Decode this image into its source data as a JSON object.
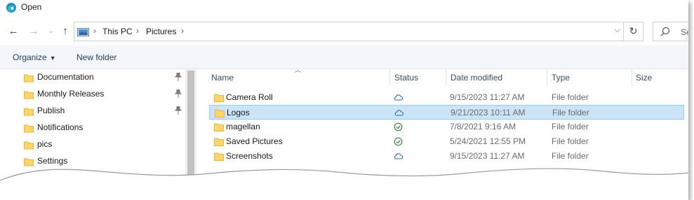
{
  "window": {
    "title": "Open"
  },
  "nav": {
    "back_icon": "arrow-left-icon",
    "forward_icon": "arrow-right-icon",
    "recent_icon": "chevron-down-icon",
    "up_icon": "arrow-up-icon"
  },
  "address": {
    "crumbs": [
      "This PC",
      "Pictures"
    ],
    "separator": "›"
  },
  "search": {
    "placeholder": "Se"
  },
  "commands": {
    "organize": "Organize",
    "new_folder": "New folder"
  },
  "sidebar": {
    "items": [
      {
        "label": "Documentation",
        "pinned": true
      },
      {
        "label": "Monthly Releases",
        "pinned": true
      },
      {
        "label": "Publish",
        "pinned": true
      },
      {
        "label": "Notifications",
        "pinned": false
      },
      {
        "label": "pics",
        "pinned": false
      },
      {
        "label": "Settings",
        "pinned": false
      }
    ]
  },
  "columns": {
    "name": "Name",
    "status": "Status",
    "date": "Date modified",
    "type": "Type",
    "size": "Size"
  },
  "files": [
    {
      "name": "Camera Roll",
      "status": "cloud",
      "date": "9/15/2023 11:27 AM",
      "type": "File folder",
      "selected": false
    },
    {
      "name": "Logos",
      "status": "cloud",
      "date": "9/21/2023 10:11 AM",
      "type": "File folder",
      "selected": true
    },
    {
      "name": "magellan",
      "status": "synced",
      "date": "7/8/2021 9:16 AM",
      "type": "File folder",
      "selected": false
    },
    {
      "name": "Saved Pictures",
      "status": "synced",
      "date": "5/24/2021 12:55 PM",
      "type": "File folder",
      "selected": false
    },
    {
      "name": "Screenshots",
      "status": "cloud",
      "date": "9/15/2023 11:27 AM",
      "type": "File folder",
      "selected": false
    }
  ],
  "colors": {
    "folder": "#ffd66b",
    "folder_dark": "#e8b534",
    "cloud": "#1e6ab8",
    "synced": "#2e8b3a",
    "selection": "#cce4f7",
    "accent": "#0067c0"
  }
}
